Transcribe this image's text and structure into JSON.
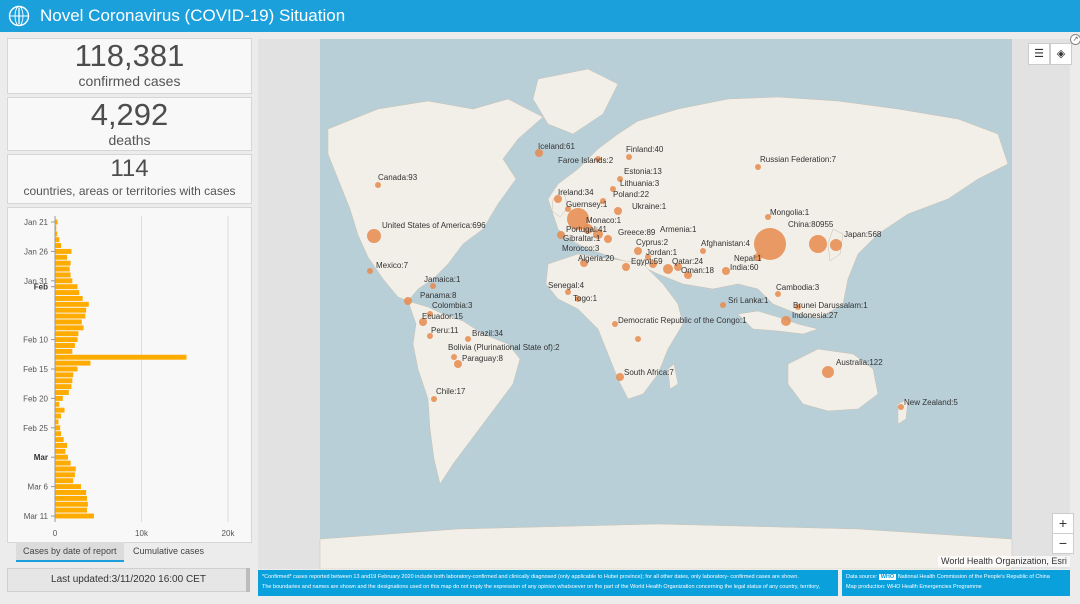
{
  "header": {
    "title": "Novel Coronavirus (COVID-19) Situation",
    "logo_icon": "who-emblem-icon",
    "bg_color": "#1ba0db"
  },
  "stats": {
    "confirmed": {
      "value": "118,381",
      "label": "confirmed cases"
    },
    "deaths": {
      "value": "4,292",
      "label": "deaths"
    },
    "countries": {
      "value": "114",
      "label": "countries, areas or territories with cases"
    }
  },
  "chart_data": {
    "type": "bar",
    "orientation": "horizontal",
    "title": "",
    "xlabel": "",
    "ylabel": "",
    "xlim": [
      0,
      20000
    ],
    "x_ticks": [
      "0",
      "10k",
      "20k"
    ],
    "y_ticks": [
      "Jan 21",
      "Jan 26",
      "Jan 31",
      "Feb",
      "Feb 10",
      "Feb 15",
      "Feb 20",
      "Feb 25",
      "Mar",
      "Mar 6",
      "Mar 11"
    ],
    "bold_ticks": [
      "Feb",
      "Mar"
    ],
    "color": "#ffab00",
    "categories": [
      "Jan 21",
      "Jan 22",
      "Jan 23",
      "Jan 24",
      "Jan 25",
      "Jan 26",
      "Jan 27",
      "Jan 28",
      "Jan 29",
      "Jan 30",
      "Jan 31",
      "Feb 1",
      "Feb 2",
      "Feb 3",
      "Feb 4",
      "Feb 5",
      "Feb 6",
      "Feb 7",
      "Feb 8",
      "Feb 9",
      "Feb 10",
      "Feb 11",
      "Feb 12",
      "Feb 13",
      "Feb 14",
      "Feb 15",
      "Feb 16",
      "Feb 17",
      "Feb 18",
      "Feb 19",
      "Feb 20",
      "Feb 21",
      "Feb 22",
      "Feb 23",
      "Feb 24",
      "Feb 25",
      "Feb 26",
      "Feb 27",
      "Feb 28",
      "Feb 29",
      "Mar 1",
      "Mar 2",
      "Mar 3",
      "Mar 4",
      "Mar 5",
      "Mar 6",
      "Mar 7",
      "Mar 8",
      "Mar 9",
      "Mar 10",
      "Mar 11"
    ],
    "values": [
      300,
      150,
      250,
      500,
      700,
      1900,
      1400,
      1800,
      1700,
      1800,
      2000,
      2600,
      2800,
      3200,
      3900,
      3600,
      3500,
      3100,
      3300,
      2700,
      2600,
      2300,
      2000,
      15200,
      4100,
      2600,
      2100,
      2000,
      1900,
      1600,
      900,
      500,
      1100,
      700,
      400,
      600,
      700,
      1000,
      1400,
      1200,
      1500,
      1800,
      2400,
      2300,
      2100,
      3000,
      3600,
      3700,
      3800,
      3700,
      4500
    ]
  },
  "tabs": [
    {
      "label": "Cases by date of report",
      "active": true
    },
    {
      "label": "Cumulative cases",
      "active": false
    }
  ],
  "last_updated": "Last updated:3/11/2020 16:00 CET",
  "map": {
    "tools": [
      "list-icon",
      "layers-icon"
    ],
    "zoom_in": "+",
    "zoom_out": "−",
    "attribution": "World Health Organization, Esri",
    "bubble_color": "#e68a4c",
    "labels": [
      {
        "text": "Iceland:61"
      },
      {
        "text": "Finland:40"
      },
      {
        "text": "Faroe Islands:2"
      },
      {
        "text": "Russian Federation:7"
      },
      {
        "text": "Estonia:13"
      },
      {
        "text": "Lithuania:3"
      },
      {
        "text": "Canada:93"
      },
      {
        "text": "Ireland:34"
      },
      {
        "text": "Poland:22"
      },
      {
        "text": "Guernsey:1"
      },
      {
        "text": "Ukraine:1"
      },
      {
        "text": "Mongolia:1"
      },
      {
        "text": "Monaco:1"
      },
      {
        "text": "United States of America:696"
      },
      {
        "text": "Portugal:41"
      },
      {
        "text": "Armenia:1"
      },
      {
        "text": "China:80955"
      },
      {
        "text": "Greece:89"
      },
      {
        "text": "Gibraltar:1"
      },
      {
        "text": "Japan:568"
      },
      {
        "text": "Cyprus:2"
      },
      {
        "text": "Morocco:3"
      },
      {
        "text": "Afghanistan:4"
      },
      {
        "text": "Jordan:1"
      },
      {
        "text": "Algeria:20"
      },
      {
        "text": "Egypt:59"
      },
      {
        "text": "Qatar:24"
      },
      {
        "text": "Nepal:1"
      },
      {
        "text": "Mexico:7"
      },
      {
        "text": "Oman:18"
      },
      {
        "text": "India:60"
      },
      {
        "text": "Jamaica:1"
      },
      {
        "text": "Senegal:4"
      },
      {
        "text": "Cambodia:3"
      },
      {
        "text": "Panama:8"
      },
      {
        "text": "Togo:1"
      },
      {
        "text": "Sri Lanka:1"
      },
      {
        "text": "Colombia:3"
      },
      {
        "text": "Brunei Darussalam:1"
      },
      {
        "text": "Ecuador:15"
      },
      {
        "text": "Indonesia:27"
      },
      {
        "text": "Democratic Republic of the Congo:1"
      },
      {
        "text": "Peru:11"
      },
      {
        "text": "Brazil:34"
      },
      {
        "text": "Bolivia (Plurinational State of):2"
      },
      {
        "text": "Paraguay:8"
      },
      {
        "text": "Australia:122"
      },
      {
        "text": "South Africa:7"
      },
      {
        "text": "Chile:17"
      },
      {
        "text": "New Zealand:5"
      }
    ]
  },
  "footer": {
    "note_line1": "*Confirmed* cases reported between 13 and19 February 2020 include both laboratory-confirmed and clinically diagnosed (only  applicable to Hubei province); for all other dates, only laboratory-  confirmed cases are shown.",
    "note_line2": "The boundaries and names are shown and the designations used on this map do not imply the expression of any opinion whatsoever on the part of the World Health Organization concerning the legal status of any country, territory,",
    "source_prefix": "Data source:",
    "source_badge": "WHO",
    "source_text": "National Health Commission of the People's Republic of China",
    "production": "Map production: WHO Health Emergencies Programme"
  }
}
